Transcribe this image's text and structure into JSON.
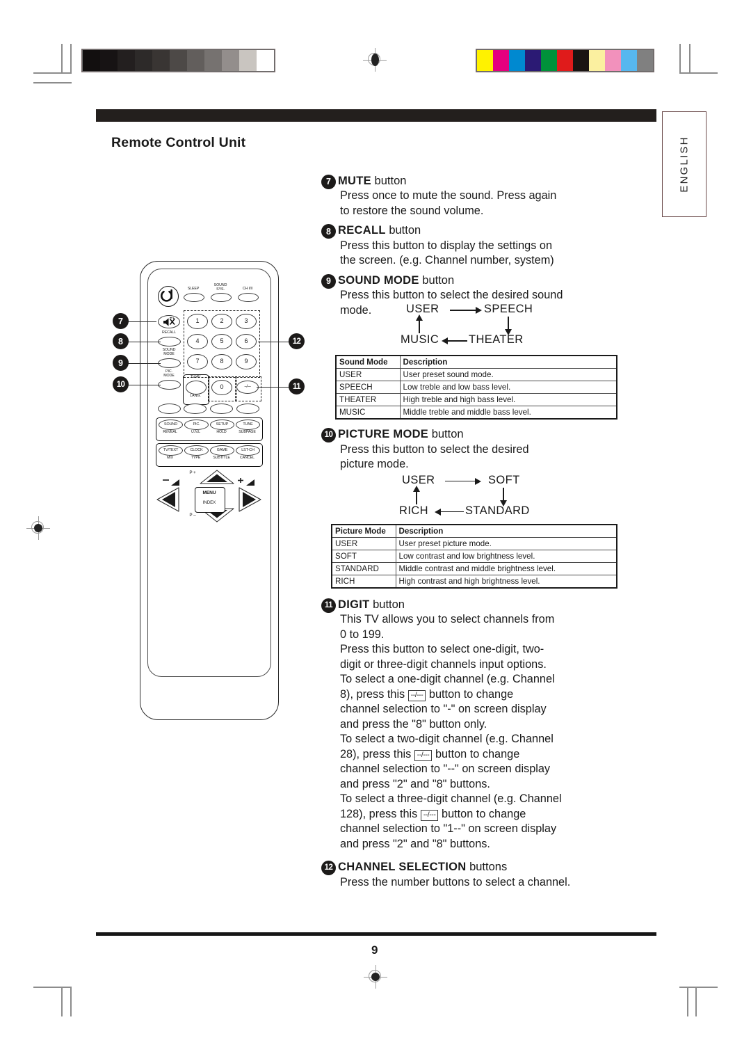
{
  "page": {
    "title": "Remote Control Unit",
    "language_tab": "ENGLISH",
    "number": "9"
  },
  "calibration": {
    "grayscale_label": "grayscale-bar",
    "grayscale": [
      "#120f0f",
      "#171314",
      "#231f1f",
      "#2d2a29",
      "#393533",
      "#4d4947",
      "#625e5c",
      "#767270",
      "#938e8c",
      "#c9c5c0",
      "#ffffff"
    ],
    "color_label": "color-bar",
    "colors": [
      "#fff200",
      "#e4007f",
      "#0089d0",
      "#2b1a74",
      "#00913a",
      "#e01b1b",
      "#1a1412",
      "#fbf0a0",
      "#f291bc",
      "#57b7ef",
      "#808080"
    ]
  },
  "sections": [
    {
      "num": "7",
      "name": "MUTE",
      "suffix": "button",
      "body": [
        "Press once to mute the sound.  Press again",
        "to restore the sound volume."
      ]
    },
    {
      "num": "8",
      "name": "RECALL",
      "suffix": "button",
      "body": [
        "Press this button to display the settings on",
        "the screen. (e.g. Channel number, system)"
      ]
    },
    {
      "num": "9",
      "name": "SOUND MODE",
      "suffix": "button",
      "body": [
        "Press this button to select the desired sound",
        "mode."
      ]
    },
    {
      "num": "10",
      "name": "PICTURE MODE",
      "suffix": "button",
      "body": [
        "Press this button to select the desired",
        "picture mode."
      ]
    },
    {
      "num": "11",
      "name": "DIGIT",
      "suffix": "button",
      "body": [
        "This TV allows you to select channels from",
        "0 to 199.",
        "Press this button to select one-digit, two-",
        "digit or three-digit channels input options."
      ]
    },
    {
      "num": "12",
      "name": "CHANNEL SELECTION",
      "suffix": "buttons",
      "body": [
        "Press the number buttons to select a channel."
      ]
    }
  ],
  "sound_flow": {
    "a": "USER",
    "b": "SPEECH",
    "c": "THEATER",
    "d": "MUSIC"
  },
  "picture_flow": {
    "a": "USER",
    "b": "SOFT",
    "c": "STANDARD",
    "d": "RICH"
  },
  "sound_table": {
    "headers": [
      "Sound Mode",
      "Description"
    ],
    "rows": [
      [
        "USER",
        "User preset sound mode."
      ],
      [
        "SPEECH",
        "Low treble and low bass level."
      ],
      [
        "THEATER",
        "High treble and high bass level."
      ],
      [
        "MUSIC",
        "Middle treble and middle bass level."
      ]
    ]
  },
  "picture_table": {
    "headers": [
      "Picture Mode",
      "Description"
    ],
    "rows": [
      [
        "USER",
        "User preset picture mode."
      ],
      [
        "SOFT",
        "Low contrast and low brightness level."
      ],
      [
        "STANDARD",
        "Middle contrast and middle brightness level."
      ],
      [
        "RICH",
        "High contrast and high brightness level."
      ]
    ]
  },
  "digit_paras": {
    "one_a": "To select a one-digit channel (e.g. Channel",
    "one_b": "8), press this",
    "one_key": "--/---",
    "one_c": "button to change",
    "one_d": "channel selection to \"-\" on screen display",
    "one_e": "and press the \"8\" button only.",
    "two_a": "To select a two-digit channel (e.g. Channel",
    "two_b": "28), press this",
    "two_key": "--/---",
    "two_c": "button to change",
    "two_d": "channel selection to \"--\" on screen display",
    "two_e": "and press \"2\" and \"8\" buttons.",
    "three_a": "To select a three-digit channel (e.g. Channel",
    "three_b": "128), press this",
    "three_key": "--/---",
    "three_c": "button to change",
    "three_d": "channel selection to \"1--\" on screen display",
    "three_e": "and press  \"2\" and \"8\" buttons."
  },
  "remote": {
    "top_row": [
      "SLEEP",
      "SOUND\nSYS.",
      "CH I/II"
    ],
    "left_caps": [
      "RECALL",
      "SOUND\nMODE",
      "PIC.\nMODE"
    ],
    "keypad": [
      "1",
      "2",
      "3",
      "4",
      "5",
      "6",
      "7",
      "8",
      "9"
    ],
    "zero": "0",
    "digit_key": "--/---",
    "tvav": "TV/AV",
    "lang": "LANG.",
    "teletext_row1_top": [
      "SOUND",
      "PIC.",
      "SETUP",
      "TUNE"
    ],
    "teletext_row1_bottom": [
      "REVEAL",
      "U.N.L",
      "HOLD",
      "SUBPAGE"
    ],
    "teletext_row2_top": [
      "TV/TEXT",
      "CLOCK",
      "GAME",
      "LST-CH"
    ],
    "teletext_row2_bottom": [
      "MIX",
      "TYPE",
      "SUBTITLE",
      "CANCEL"
    ],
    "nav": {
      "p_plus": "P +",
      "p_minus": "P –",
      "menu": "MENU",
      "index": "INDEX",
      "vol_down": "–",
      "vol_up": "+"
    },
    "callouts": [
      "7",
      "8",
      "9",
      "10",
      "11",
      "12"
    ]
  }
}
